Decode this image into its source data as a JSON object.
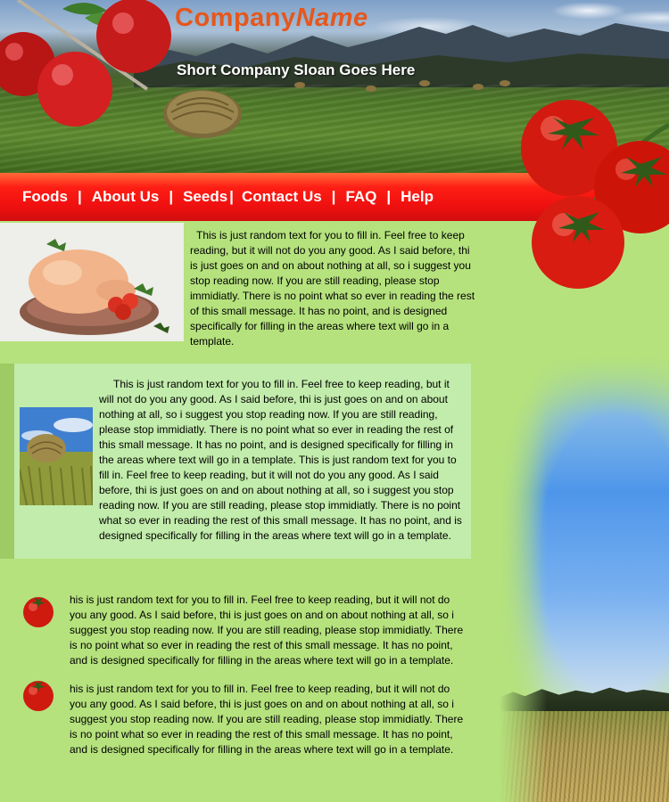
{
  "header": {
    "logo_part1": "Company",
    "logo_part2": "Name",
    "slogan": "Short Company Sloan Goes Here"
  },
  "nav": {
    "items": [
      "Foods",
      "About Us",
      "Seeds",
      "Contact Us",
      "FAQ",
      "Help"
    ],
    "separator": "|"
  },
  "images": {
    "header_apples": "red-apples-on-branch",
    "header_photo": "field-mountains-hay-bales",
    "header_tomatoes": "tomatoes-on-vine",
    "section1": "roast-chicken-plate",
    "section2": "hay-bale-field-photo",
    "bullet_icon": "tomato-icon",
    "right_decor": "sky-wheat-field-photo"
  },
  "colors": {
    "page_background": "#b5e27d",
    "logo": "#e5571c",
    "nav_bar": "#ee1010",
    "section2_background": "#c2ecab"
  },
  "content": {
    "section1_text": "This is just random text for you to fill in.  Feel free to keep reading, but it will not do you any good.  As I said before, thi is just goes on and on about nothing at all, so i suggest you stop reading now.  If you are still reading, please stop immidiatly.  There is no point what so ever in reading the rest of this small message.  It has no point, and is designed specifically for filling in the areas where text will go in a template.",
    "section2_text": "This is just random text for you to fill in.  Feel free to keep reading, but it will not do you any good.  As I said before, thi is just goes on and on about nothing at all, so i suggest you stop reading now.  If you are still reading, please stop immidiatly.  There is no point what so ever in reading the rest of this small message.  It has no point, and is designed specifically for filling in the areas where text will go in a template.     This is just random text for you to fill in.  Feel free to keep reading, but it will not do you any good.  As I said before, thi is just goes on and on about nothing at all, so i suggest you stop reading now.  If you are still reading, please stop immidiatly.  There is no point what so ever in reading the rest of this small message.  It has no point, and is designed specifi­cally for filling in the areas where text will go in a template.",
    "bullet1_text": "his is just random text for you to fill in.  Feel free to keep reading, but it will not do you any good.  As I said before, thi is just goes on and on about nothing at all, so i suggest you stop reading now.  If you are still reading, please stop immidiatly.  There is no point what so ever in reading the rest of this small message.  It has no point, and is designed specifically for filling in the areas where text will go in a template.",
    "bullet2_text": "his is just random text for you to fill in.  Feel free to keep reading, but it will not do you any good.  As I said before, thi is just goes on and on about nothing at all, so i suggest you stop reading now.  If you are still reading, please stop immidiatly.  There is no point what so ever in reading the rest of this small message.  It has no point, and is designed specifically for filling in the areas where text will go in a template."
  }
}
